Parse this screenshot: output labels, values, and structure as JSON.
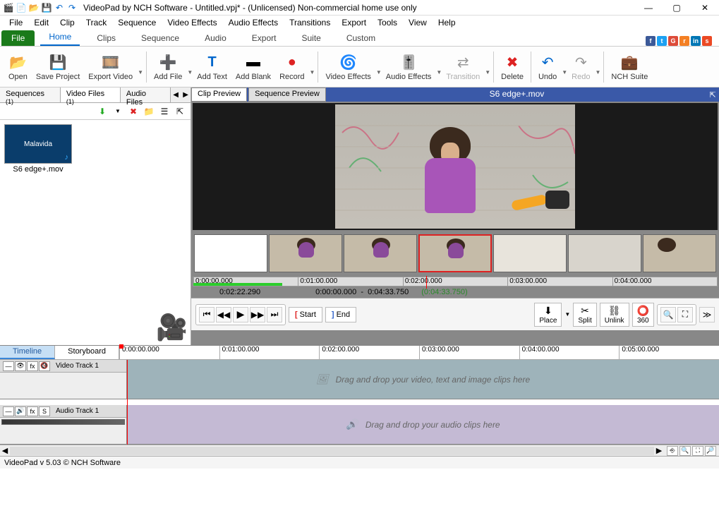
{
  "title": "VideoPad by NCH Software - Untitled.vpj* - (Unlicensed) Non-commercial home use only",
  "menu": [
    "File",
    "Edit",
    "Clip",
    "Track",
    "Sequence",
    "Video Effects",
    "Audio Effects",
    "Transitions",
    "Export",
    "Tools",
    "View",
    "Help"
  ],
  "ribbon_file": "File",
  "ribbon_tabs": [
    "Home",
    "Clips",
    "Sequence",
    "Audio",
    "Export",
    "Suite",
    "Custom"
  ],
  "ribbon": {
    "open": "Open",
    "save": "Save Project",
    "export": "Export Video",
    "addfile": "Add File",
    "addtext": "Add Text",
    "addblank": "Add Blank",
    "record": "Record",
    "videoeffects": "Video Effects",
    "audioeffects": "Audio Effects",
    "transition": "Transition",
    "delete": "Delete",
    "undo": "Undo",
    "redo": "Redo",
    "nchsuite": "NCH Suite"
  },
  "bin_tabs": {
    "sequences": "Sequences",
    "seq_count": "(1)",
    "videos": "Video Files",
    "vid_count": "(1)",
    "audio": "Audio Files"
  },
  "clip_name": "S6 edge+.mov",
  "thumb_caption": "Malavida",
  "preview_tabs": {
    "clip": "Clip Preview",
    "seq": "Sequence Preview"
  },
  "preview_title": "S6 edge+.mov",
  "scrub_marks": [
    "0:00:00.000",
    "0:01:00.000",
    "0:02:00.000",
    "0:03:00.000",
    "0:04:00.000"
  ],
  "tc": {
    "pos": "0:02:22.290",
    "range_start": "0:00:00.000",
    "range_end": "0:04:33.750",
    "dur": "(0:04:33.750)"
  },
  "pc": {
    "start": "Start",
    "end": "End",
    "place": "Place",
    "split": "Split",
    "unlink": "Unlink",
    "threesixty": "360"
  },
  "tl_tabs": {
    "timeline": "Timeline",
    "storyboard": "Storyboard"
  },
  "tl_marks": [
    "0:00:00.000",
    "0:01:00.000",
    "0:02:00.000",
    "0:03:00.000",
    "0:04:00.000",
    "0:05:00.000"
  ],
  "tracks": {
    "video": "Video Track 1",
    "audio": "Audio Track 1"
  },
  "drop_video": "Drag and drop your video, text and image clips here",
  "drop_audio": "Drag and drop your audio clips here",
  "status": "VideoPad v 5.03 © NCH Software"
}
